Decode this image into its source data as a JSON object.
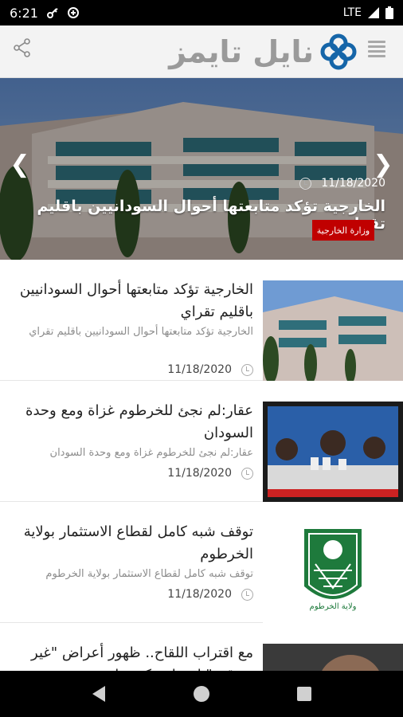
{
  "status_bar": {
    "time": "6:21",
    "network": "LTE"
  },
  "app_bar": {
    "logo_text": "نايل تايمز",
    "share_icon": "share-icon",
    "menu_icon": "hamburger-menu-icon",
    "logo_color": "#1565a8"
  },
  "hero": {
    "date": "11/18/2020",
    "title": "الخارجية تؤكد متابعتها أحوال السودانيين باقليم تقراي",
    "tag": "وزارة الخارجية",
    "tag_color": "#c00000"
  },
  "news": [
    {
      "title": "الخارجية تؤكد متابعتها أحوال السودانيين باقليم تقراي",
      "subtitle": "الخارجية تؤكد متابعتها أحوال السودانيين باقليم تقراي",
      "date": "11/18/2020"
    },
    {
      "title": "عقار:لم نجئ للخرطوم غزاة ومع وحدة السودان",
      "subtitle": "عقار:لم نجئ للخرطوم غزاة ومع وحدة السودان",
      "date": "11/18/2020"
    },
    {
      "title": "توقف شبه كامل لقطاع الاستثمار بولاية الخرطوم",
      "subtitle": "توقف شبه كامل لقطاع الاستثمار بولاية الخرطوم",
      "date": "11/18/2020",
      "thumb_caption": "ولاية الخرطوم"
    },
    {
      "title": "مع اقتراب اللقاح.. ظهور أعراض \"غير متوقعة\" لمصابي كورونا"
    }
  ]
}
